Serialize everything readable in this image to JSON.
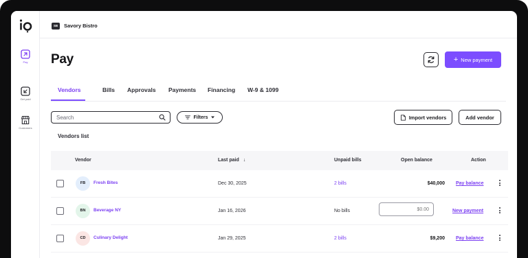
{
  "app": {
    "logo_text": "io",
    "org_initials": "SB",
    "org_name": "Savory Bistro"
  },
  "sidebar": {
    "items": [
      {
        "label": "Pay",
        "icon": "arrow-up-right-icon",
        "active": true
      },
      {
        "label": "Get paid",
        "icon": "arrow-down-left-icon",
        "active": false
      },
      {
        "label": "Customers",
        "icon": "storefront-icon",
        "active": false
      }
    ]
  },
  "header": {
    "title": "Pay",
    "new_payment_label": "New payment"
  },
  "tabs": [
    "Vendors",
    "Bills",
    "Approvals",
    "Payments",
    "Financing",
    "W-9 & 1099"
  ],
  "toolbar": {
    "search_placeholder": "Search",
    "filters_label": "Filters",
    "import_label": "Import vendors",
    "add_vendor_label": "Add vendor"
  },
  "list_title": "Vendors list",
  "table": {
    "columns": {
      "vendor": "Vendor",
      "last_paid": "Last paid",
      "last_paid_sort": "↓",
      "unpaid_bills": "Unpaid bills",
      "open_balance": "Open balance",
      "action": "Action"
    },
    "rows": [
      {
        "initials": "FB",
        "name": "Fresh Bites",
        "last_paid": "Dec 30, 2025",
        "unpaid": "2 bills",
        "balance": "$40,000",
        "action": "Pay balance",
        "avatar_color": "#e3eefc"
      },
      {
        "initials": "BN",
        "name": "Beverage NY",
        "last_paid": "Jan 16, 2026",
        "unpaid": "No bills",
        "balance_placeholder": "$0.00",
        "action": "New payment",
        "avatar_color": "#e3f5ea"
      },
      {
        "initials": "CD",
        "name": "Culinary Delight",
        "last_paid": "Jan 29, 2025",
        "unpaid": "2 bills",
        "balance": "$9,200",
        "action": "Pay balance",
        "avatar_color": "#fbe6e4"
      }
    ]
  },
  "colors": {
    "accent": "#7c4dff",
    "link": "#7b3ff2",
    "frame": "#0d0d0e"
  }
}
